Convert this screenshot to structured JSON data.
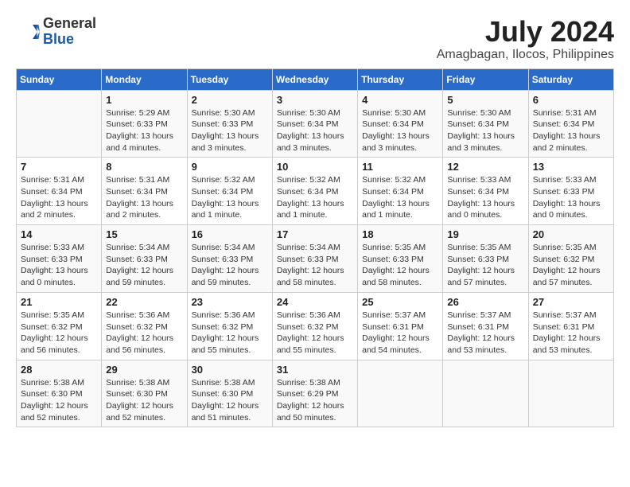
{
  "header": {
    "logo_line1": "General",
    "logo_line2": "Blue",
    "month_year": "July 2024",
    "location": "Amagbagan, Ilocos, Philippines"
  },
  "calendar": {
    "days_of_week": [
      "Sunday",
      "Monday",
      "Tuesday",
      "Wednesday",
      "Thursday",
      "Friday",
      "Saturday"
    ],
    "weeks": [
      [
        {
          "day": "",
          "info": ""
        },
        {
          "day": "1",
          "info": "Sunrise: 5:29 AM\nSunset: 6:33 PM\nDaylight: 13 hours\nand 4 minutes."
        },
        {
          "day": "2",
          "info": "Sunrise: 5:30 AM\nSunset: 6:33 PM\nDaylight: 13 hours\nand 3 minutes."
        },
        {
          "day": "3",
          "info": "Sunrise: 5:30 AM\nSunset: 6:34 PM\nDaylight: 13 hours\nand 3 minutes."
        },
        {
          "day": "4",
          "info": "Sunrise: 5:30 AM\nSunset: 6:34 PM\nDaylight: 13 hours\nand 3 minutes."
        },
        {
          "day": "5",
          "info": "Sunrise: 5:30 AM\nSunset: 6:34 PM\nDaylight: 13 hours\nand 3 minutes."
        },
        {
          "day": "6",
          "info": "Sunrise: 5:31 AM\nSunset: 6:34 PM\nDaylight: 13 hours\nand 2 minutes."
        }
      ],
      [
        {
          "day": "7",
          "info": "Sunrise: 5:31 AM\nSunset: 6:34 PM\nDaylight: 13 hours\nand 2 minutes."
        },
        {
          "day": "8",
          "info": "Sunrise: 5:31 AM\nSunset: 6:34 PM\nDaylight: 13 hours\nand 2 minutes."
        },
        {
          "day": "9",
          "info": "Sunrise: 5:32 AM\nSunset: 6:34 PM\nDaylight: 13 hours\nand 1 minute."
        },
        {
          "day": "10",
          "info": "Sunrise: 5:32 AM\nSunset: 6:34 PM\nDaylight: 13 hours\nand 1 minute."
        },
        {
          "day": "11",
          "info": "Sunrise: 5:32 AM\nSunset: 6:34 PM\nDaylight: 13 hours\nand 1 minute."
        },
        {
          "day": "12",
          "info": "Sunrise: 5:33 AM\nSunset: 6:34 PM\nDaylight: 13 hours\nand 0 minutes."
        },
        {
          "day": "13",
          "info": "Sunrise: 5:33 AM\nSunset: 6:33 PM\nDaylight: 13 hours\nand 0 minutes."
        }
      ],
      [
        {
          "day": "14",
          "info": "Sunrise: 5:33 AM\nSunset: 6:33 PM\nDaylight: 13 hours\nand 0 minutes."
        },
        {
          "day": "15",
          "info": "Sunrise: 5:34 AM\nSunset: 6:33 PM\nDaylight: 12 hours\nand 59 minutes."
        },
        {
          "day": "16",
          "info": "Sunrise: 5:34 AM\nSunset: 6:33 PM\nDaylight: 12 hours\nand 59 minutes."
        },
        {
          "day": "17",
          "info": "Sunrise: 5:34 AM\nSunset: 6:33 PM\nDaylight: 12 hours\nand 58 minutes."
        },
        {
          "day": "18",
          "info": "Sunrise: 5:35 AM\nSunset: 6:33 PM\nDaylight: 12 hours\nand 58 minutes."
        },
        {
          "day": "19",
          "info": "Sunrise: 5:35 AM\nSunset: 6:33 PM\nDaylight: 12 hours\nand 57 minutes."
        },
        {
          "day": "20",
          "info": "Sunrise: 5:35 AM\nSunset: 6:32 PM\nDaylight: 12 hours\nand 57 minutes."
        }
      ],
      [
        {
          "day": "21",
          "info": "Sunrise: 5:35 AM\nSunset: 6:32 PM\nDaylight: 12 hours\nand 56 minutes."
        },
        {
          "day": "22",
          "info": "Sunrise: 5:36 AM\nSunset: 6:32 PM\nDaylight: 12 hours\nand 56 minutes."
        },
        {
          "day": "23",
          "info": "Sunrise: 5:36 AM\nSunset: 6:32 PM\nDaylight: 12 hours\nand 55 minutes."
        },
        {
          "day": "24",
          "info": "Sunrise: 5:36 AM\nSunset: 6:32 PM\nDaylight: 12 hours\nand 55 minutes."
        },
        {
          "day": "25",
          "info": "Sunrise: 5:37 AM\nSunset: 6:31 PM\nDaylight: 12 hours\nand 54 minutes."
        },
        {
          "day": "26",
          "info": "Sunrise: 5:37 AM\nSunset: 6:31 PM\nDaylight: 12 hours\nand 53 minutes."
        },
        {
          "day": "27",
          "info": "Sunrise: 5:37 AM\nSunset: 6:31 PM\nDaylight: 12 hours\nand 53 minutes."
        }
      ],
      [
        {
          "day": "28",
          "info": "Sunrise: 5:38 AM\nSunset: 6:30 PM\nDaylight: 12 hours\nand 52 minutes."
        },
        {
          "day": "29",
          "info": "Sunrise: 5:38 AM\nSunset: 6:30 PM\nDaylight: 12 hours\nand 52 minutes."
        },
        {
          "day": "30",
          "info": "Sunrise: 5:38 AM\nSunset: 6:30 PM\nDaylight: 12 hours\nand 51 minutes."
        },
        {
          "day": "31",
          "info": "Sunrise: 5:38 AM\nSunset: 6:29 PM\nDaylight: 12 hours\nand 50 minutes."
        },
        {
          "day": "",
          "info": ""
        },
        {
          "day": "",
          "info": ""
        },
        {
          "day": "",
          "info": ""
        }
      ]
    ]
  }
}
